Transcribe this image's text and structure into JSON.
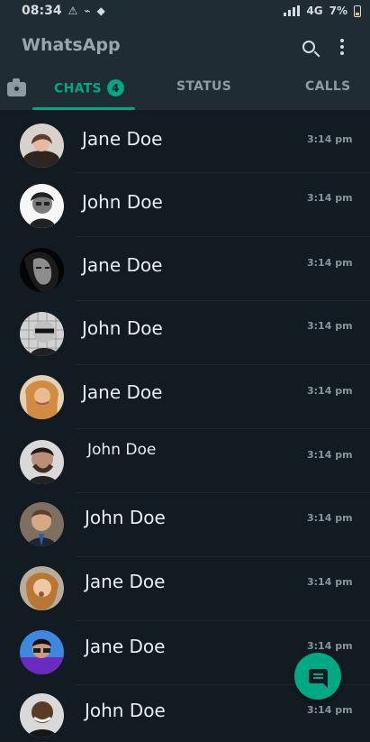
{
  "status_bar": {
    "time": "08:34",
    "icons": [
      "warning-icon",
      "antenna-icon",
      "android-icon"
    ],
    "network": "4G",
    "battery": "7%"
  },
  "header": {
    "title": "WhatsApp",
    "icons": [
      "search-icon",
      "more-options-icon"
    ]
  },
  "tabs": {
    "camera_icon": "camera-icon",
    "chats": "CHATS",
    "chats_badge": "4",
    "status": "STATUS",
    "calls": "CALLS"
  },
  "chats": [
    {
      "name": "Jane Doe",
      "time": "3:14 pm"
    },
    {
      "name": "John Doe",
      "time": "3:14 pm"
    },
    {
      "name": "Jane Doe",
      "time": "3:14 pm"
    },
    {
      "name": "John Doe",
      "time": "3:14 pm"
    },
    {
      "name": "Jane Doe",
      "time": "3:14 pm"
    },
    {
      "name": "John Doe",
      "time": "3:14 pm"
    },
    {
      "name": "John Doe",
      "time": "3:14 pm"
    },
    {
      "name": "Jane Doe",
      "time": "3:14 pm"
    },
    {
      "name": "Jane Doe",
      "time": "3:14 pm"
    },
    {
      "name": "John Doe",
      "time": "3:14 pm"
    }
  ],
  "fab": {
    "icon": "new-chat-icon"
  },
  "colors": {
    "accent": "#00a884",
    "background": "#121b22",
    "header": "#1f2c33"
  }
}
